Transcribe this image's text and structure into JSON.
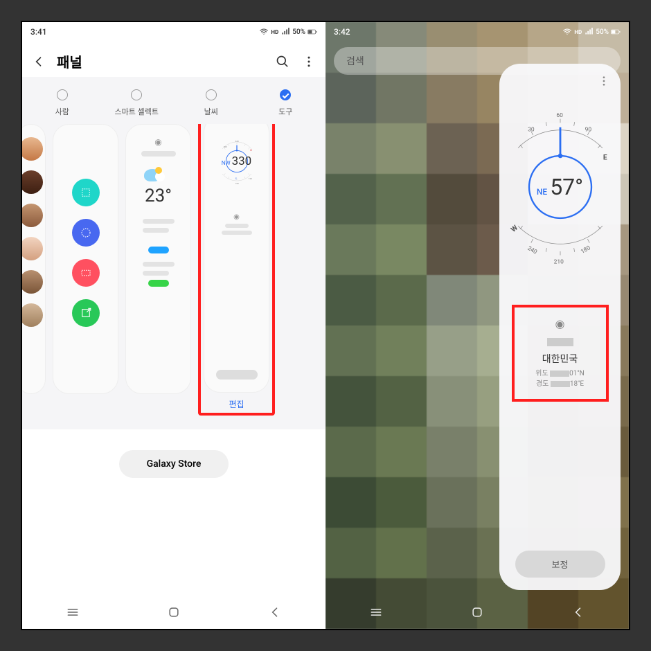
{
  "left": {
    "status_time": "3:41",
    "status_pct": "50%",
    "header_title": "패널",
    "tabs": [
      "사람",
      "스마트 셀렉트",
      "날씨",
      "도구"
    ],
    "weather_temp": "23°",
    "compass_dir": "NW",
    "compass_deg": "330",
    "edit": "편집",
    "store": "Galaxy Store"
  },
  "right": {
    "status_time": "3:42",
    "status_pct": "50%",
    "search_placeholder": "검색",
    "compass_dir": "NE",
    "compass_deg": "57°",
    "country": "대한민국",
    "lat_label": "위도",
    "lat_suffix": "01\"N",
    "lon_label": "경도",
    "lon_suffix": "18\"E",
    "calibrate": "보정"
  }
}
